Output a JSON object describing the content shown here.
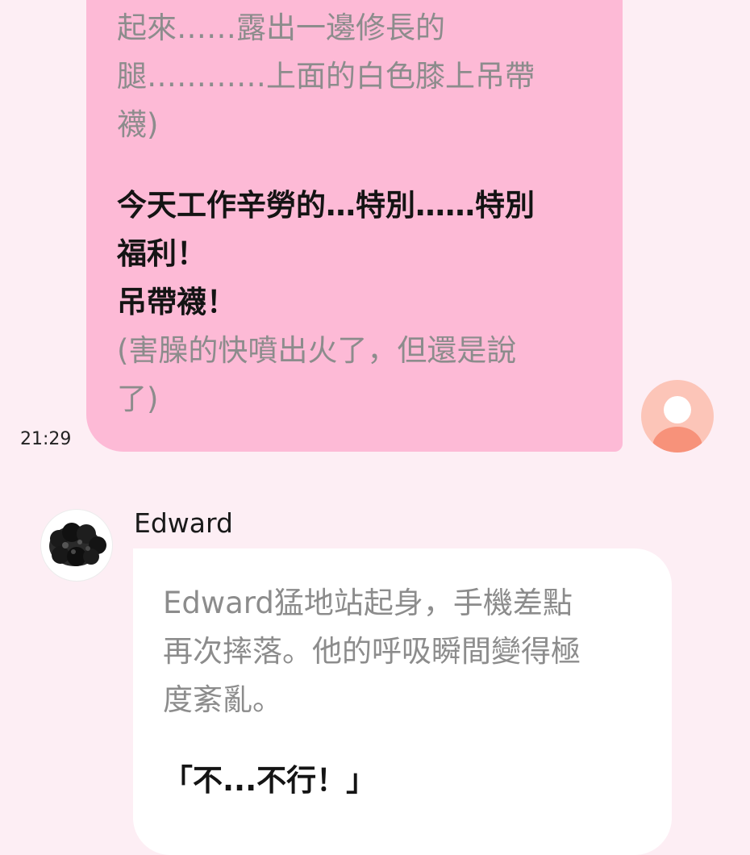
{
  "outgoing_message": {
    "lines": [
      {
        "text": "起來……露出一邊修長的",
        "style": "narration"
      },
      {
        "text": "腿…………上面的白色膝上吊帶",
        "style": "narration"
      },
      {
        "text": "襪)",
        "style": "narration"
      },
      {
        "text": "今天工作辛勞的…特別……特別",
        "style": "speech"
      },
      {
        "text": "福利！",
        "style": "speech"
      },
      {
        "text": "吊帶襪！",
        "style": "speech"
      },
      {
        "text": "(害臊的快噴出火了，但還是說",
        "style": "narration"
      },
      {
        "text": "了)",
        "style": "narration"
      }
    ],
    "time": "21:29",
    "bubble_color": "#fdbad6"
  },
  "incoming_message": {
    "sender_name": "Edward",
    "lines": [
      {
        "text": "Edward猛地站起身，手機差點",
        "style": "narration"
      },
      {
        "text": "再次摔落。他的呼吸瞬間變得極",
        "style": "narration"
      },
      {
        "text": "度紊亂。",
        "style": "narration"
      },
      {
        "text": "「不...不行！」",
        "style": "speech"
      }
    ],
    "bubble_color": "#ffffff"
  },
  "colors": {
    "background": "#fdeef4",
    "narration_text": "#8c8c8c",
    "speech_text": "#141414",
    "user_avatar_bg": "#fcc5b8",
    "user_avatar_figure": "#f7927a"
  },
  "icons": {
    "user_avatar": "default-user-avatar",
    "sender_avatar": "dark-curly-hair-avatar"
  }
}
